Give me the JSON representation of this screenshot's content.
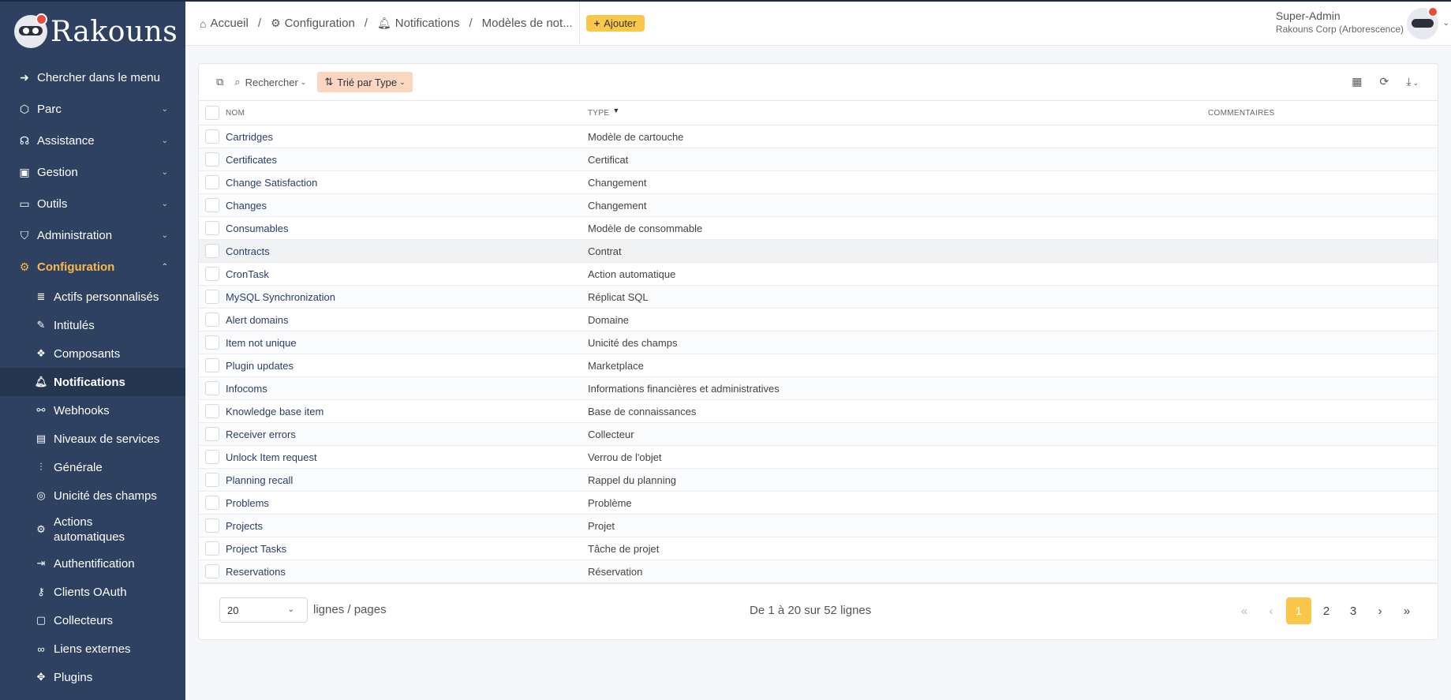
{
  "brand": {
    "name": "Rakouns"
  },
  "sidebar": {
    "menu": [
      {
        "label": "Chercher dans le menu",
        "icon": "arrow-right-icon",
        "chevron": false
      },
      {
        "label": "Parc",
        "icon": "cube-icon",
        "chevron": true
      },
      {
        "label": "Assistance",
        "icon": "headset-icon",
        "chevron": true
      },
      {
        "label": "Gestion",
        "icon": "wallet-icon",
        "chevron": true
      },
      {
        "label": "Outils",
        "icon": "briefcase-icon",
        "chevron": true
      },
      {
        "label": "Administration",
        "icon": "shield-icon",
        "chevron": true
      }
    ],
    "config": {
      "label": "Configuration",
      "icon": "gear-icon"
    },
    "subitems": [
      {
        "label": "Actifs personnalisés",
        "icon": "database-icon"
      },
      {
        "label": "Intitulés",
        "icon": "edit-icon"
      },
      {
        "label": "Composants",
        "icon": "components-icon"
      },
      {
        "label": "Notifications",
        "icon": "bell-icon"
      },
      {
        "label": "Webhooks",
        "icon": "webhook-icon"
      },
      {
        "label": "Niveaux de services",
        "icon": "clipboard-icon"
      },
      {
        "label": "Générale",
        "icon": "sliders-icon"
      },
      {
        "label": "Unicité des champs",
        "icon": "fingerprint-icon"
      },
      {
        "label": "Actions automatiques",
        "icon": "gear-icon"
      },
      {
        "label": "Authentification",
        "icon": "login-icon"
      },
      {
        "label": "Clients OAuth",
        "icon": "key-icon"
      },
      {
        "label": "Collecteurs",
        "icon": "inbox-icon"
      },
      {
        "label": "Liens externes",
        "icon": "link-icon"
      },
      {
        "label": "Plugins",
        "icon": "puzzle-icon"
      }
    ]
  },
  "header": {
    "breadcrumb": [
      "Accueil",
      "Configuration",
      "Notifications",
      "Modèles de not..."
    ],
    "add_label": "Ajouter",
    "user_name": "Super-Admin",
    "user_entity": "Rakouns Corp (Arborescence)"
  },
  "toolbar": {
    "search_label": "Rechercher",
    "sort_label": "Trié par Type"
  },
  "table": {
    "columns": [
      "NOM",
      "TYPE",
      "COMMENTAIRES"
    ],
    "rows": [
      {
        "nom": "Cartridges",
        "type": "Modèle de cartouche"
      },
      {
        "nom": "Certificates",
        "type": "Certificat"
      },
      {
        "nom": "Change Satisfaction",
        "type": "Changement"
      },
      {
        "nom": "Changes",
        "type": "Changement"
      },
      {
        "nom": "Consumables",
        "type": "Modèle de consommable"
      },
      {
        "nom": "Contracts",
        "type": "Contrat"
      },
      {
        "nom": "CronTask",
        "type": "Action automatique"
      },
      {
        "nom": "MySQL Synchronization",
        "type": "Réplicat SQL"
      },
      {
        "nom": "Alert domains",
        "type": "Domaine"
      },
      {
        "nom": "Item not unique",
        "type": "Unicité des champs"
      },
      {
        "nom": "Plugin updates",
        "type": "Marketplace"
      },
      {
        "nom": "Infocoms",
        "type": "Informations financières et administratives"
      },
      {
        "nom": "Knowledge base item",
        "type": "Base de connaissances"
      },
      {
        "nom": "Receiver errors",
        "type": "Collecteur"
      },
      {
        "nom": "Unlock Item request",
        "type": "Verrou de l'objet"
      },
      {
        "nom": "Planning recall",
        "type": "Rappel du planning"
      },
      {
        "nom": "Problems",
        "type": "Problème"
      },
      {
        "nom": "Projects",
        "type": "Projet"
      },
      {
        "nom": "Project Tasks",
        "type": "Tâche de projet"
      },
      {
        "nom": "Reservations",
        "type": "Réservation"
      }
    ]
  },
  "footer": {
    "page_size": "20",
    "lines_label": "lignes / pages",
    "page_info": "De 1 à 20 sur 52 lignes",
    "pages": [
      "1",
      "2",
      "3"
    ],
    "current_page": "1"
  },
  "colors": {
    "sidebar": "#2f4160",
    "accent": "#fbc74a",
    "active_menu": "#fbb94a",
    "sort_button": "#fbd7c2"
  }
}
